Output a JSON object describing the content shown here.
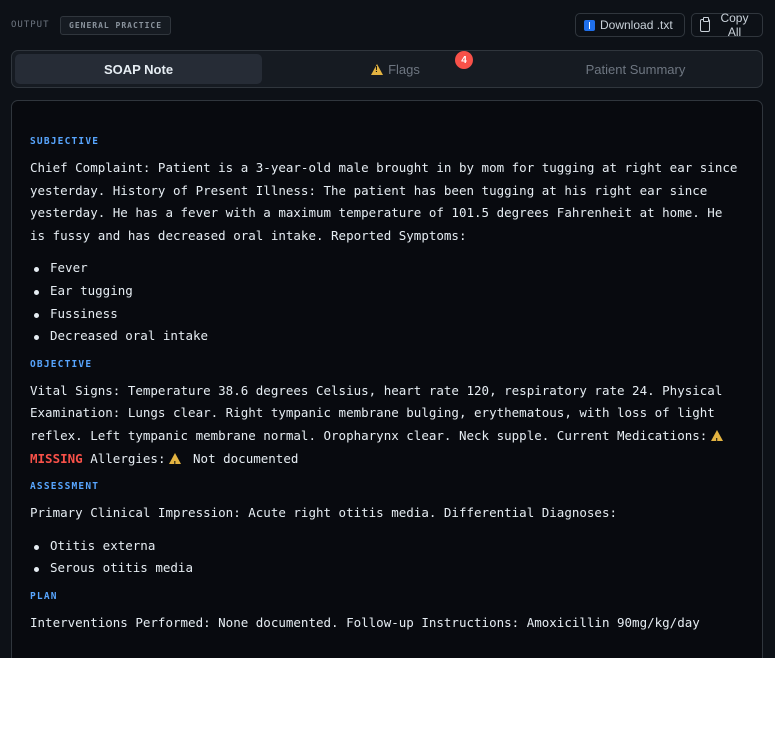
{
  "header": {
    "output_label": "OUTPUT",
    "mode_badge": "GENERAL PRACTICE",
    "download_label": "Download .txt",
    "copy_label": "Copy All"
  },
  "tabs": [
    {
      "label": "SOAP Note",
      "active": true
    },
    {
      "label": "Flags",
      "badge": "4"
    },
    {
      "label": "Patient Summary"
    }
  ],
  "note": {
    "subjective": {
      "heading": "SUBJECTIVE",
      "text": "Chief Complaint: Patient is a 3-year-old male brought in by mom for tugging at right ear since yesterday. History of Present Illness: The patient has been tugging at his right ear since yesterday. He has a fever with a maximum temperature of 101.5 degrees Fahrenheit at home. He is fussy and has decreased oral intake. Reported Symptoms:",
      "symptoms": [
        "Fever",
        "Ear tugging",
        "Fussiness",
        "Decreased oral intake"
      ]
    },
    "objective": {
      "heading": "OBJECTIVE",
      "text": "Vital Signs: Temperature 38.6 degrees Celsius, heart rate 120, respiratory rate 24. Physical Examination: Lungs clear. Right tympanic membrane bulging, erythematous, with loss of light reflex. Left tympanic membrane normal. Oropharynx clear. Neck supple. Current Medications:",
      "missing_label": "MISSING",
      "allergies_label": "Allergies:",
      "allergies_value": "Not documented"
    },
    "assessment": {
      "heading": "ASSESSMENT",
      "text": "Primary Clinical Impression: Acute right otitis media. Differential Diagnoses:",
      "differentials": [
        "Otitis externa",
        "Serous otitis media"
      ]
    },
    "plan": {
      "heading": "PLAN",
      "text": "Interventions Performed: None documented. Follow-up Instructions: Amoxicillin 90mg/kg/day"
    }
  },
  "colors": {
    "background": "#0d1117",
    "accent": "#58a6ff",
    "missing": "#f85149",
    "warning": "#e3b341"
  }
}
